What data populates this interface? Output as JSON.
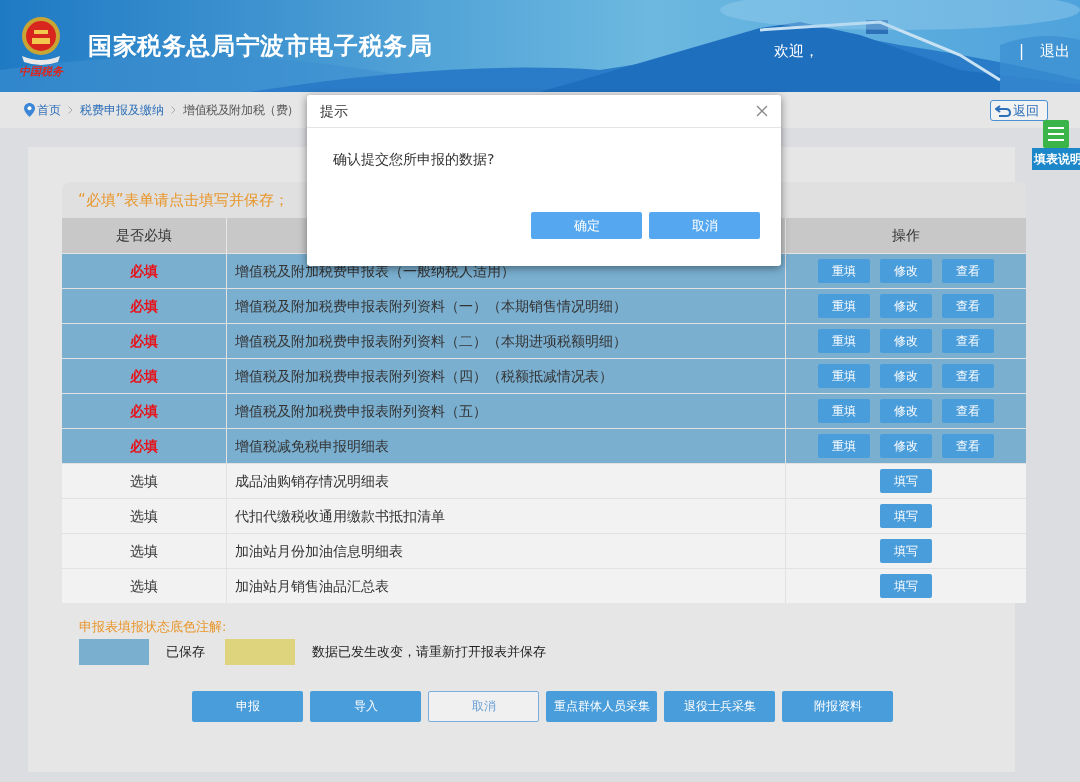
{
  "header": {
    "logo_caption": "中国税务",
    "title": "国家税务总局宁波市电子税务局",
    "welcome": "欢迎，",
    "separator": "|",
    "logout": "退出"
  },
  "breadcrumb": [
    {
      "label": "首页",
      "link": true
    },
    {
      "label": "税费申报及缴纳",
      "link": true
    },
    {
      "label": "增值税及附加税（费）",
      "link": false
    }
  ],
  "back_button": "返回",
  "side_tab": "填表说明",
  "notice": "“必填”表单请点击填写并保存；",
  "table": {
    "columns": [
      "是否必填",
      "操作"
    ],
    "rows": [
      {
        "required": true,
        "requirement": "必填",
        "name": "增值税及附加税费申报表（一般纳税人适用）",
        "saved": true,
        "actions": [
          "重填",
          "修改",
          "查看"
        ]
      },
      {
        "required": true,
        "requirement": "必填",
        "name": "增值税及附加税费申报表附列资料（一）（本期销售情况明细）",
        "saved": true,
        "actions": [
          "重填",
          "修改",
          "查看"
        ]
      },
      {
        "required": true,
        "requirement": "必填",
        "name": "增值税及附加税费申报表附列资料（二）（本期进项税额明细）",
        "saved": true,
        "actions": [
          "重填",
          "修改",
          "查看"
        ]
      },
      {
        "required": true,
        "requirement": "必填",
        "name": "增值税及附加税费申报表附列资料（四）（税额抵减情况表）",
        "saved": true,
        "actions": [
          "重填",
          "修改",
          "查看"
        ]
      },
      {
        "required": true,
        "requirement": "必填",
        "name": "增值税及附加税费申报表附列资料（五）",
        "saved": true,
        "actions": [
          "重填",
          "修改",
          "查看"
        ]
      },
      {
        "required": true,
        "requirement": "必填",
        "name": "增值税减免税申报明细表",
        "saved": true,
        "actions": [
          "重填",
          "修改",
          "查看"
        ]
      },
      {
        "required": false,
        "requirement": "选填",
        "name": "成品油购销存情况明细表",
        "saved": false,
        "actions": [
          "填写"
        ]
      },
      {
        "required": false,
        "requirement": "选填",
        "name": "代扣代缴税收通用缴款书抵扣清单",
        "saved": false,
        "actions": [
          "填写"
        ]
      },
      {
        "required": false,
        "requirement": "选填",
        "name": "加油站月份加油信息明细表",
        "saved": false,
        "actions": [
          "填写"
        ]
      },
      {
        "required": false,
        "requirement": "选填",
        "name": "加油站月销售油品汇总表",
        "saved": false,
        "actions": [
          "填写"
        ]
      }
    ]
  },
  "legend": {
    "title": "申报表填报状态底色注解:",
    "items": [
      {
        "label": "已保存",
        "color": "#7aafd0"
      },
      {
        "label": "数据已发生改变，请重新打开报表并保存",
        "color": "#dfd47e"
      }
    ]
  },
  "buttons": [
    {
      "label": "申报",
      "kind": "primary"
    },
    {
      "label": "导入",
      "kind": "primary"
    },
    {
      "label": "取消",
      "kind": "outline"
    },
    {
      "label": "重点群体人员采集",
      "kind": "primary"
    },
    {
      "label": "退役士兵采集",
      "kind": "primary"
    },
    {
      "label": "附报资料",
      "kind": "primary"
    }
  ],
  "dialog": {
    "title": "提示",
    "message": "确认提交您所申报的数据?",
    "buttons": [
      "确定",
      "取消"
    ]
  }
}
